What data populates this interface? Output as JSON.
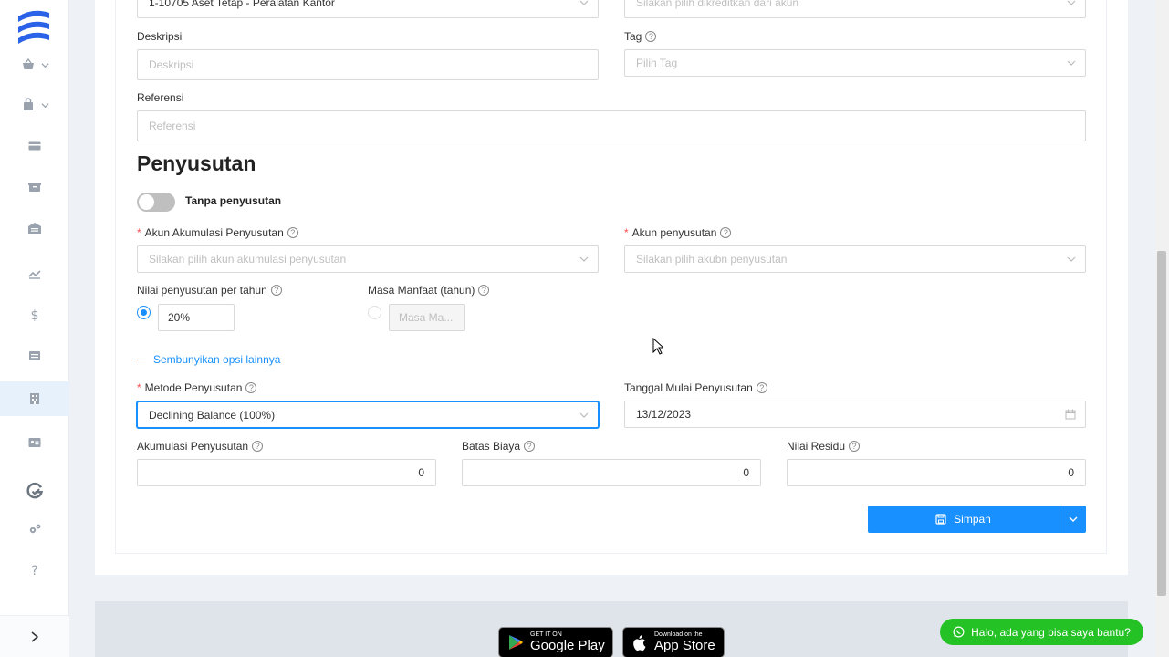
{
  "form": {
    "top_account_value": "1-10705 Aset Tetap - Peralatan Kantor",
    "top_credit_placeholder": "Silakan pilih dikreditkan dari akun",
    "description_label": "Deskripsi",
    "description_placeholder": "Deskripsi",
    "tag_label": "Tag",
    "tag_placeholder": "Pilih Tag",
    "reference_label": "Referensi",
    "reference_placeholder": "Referensi"
  },
  "depreciation": {
    "title": "Penyusutan",
    "toggle_label": "Tanpa penyusutan",
    "accum_account_label": "Akun Akumulasi Penyusutan",
    "accum_account_placeholder": "Silakan pilih akun akumulasi penyusutan",
    "dep_account_label": "Akun penyusutan",
    "dep_account_placeholder": "Silakan pilih akubn penyusutan",
    "yearly_value_label": "Nilai penyusutan per tahun",
    "yearly_value": "20%",
    "useful_life_label": "Masa Manfaat (tahun)",
    "useful_life_placeholder": "Masa Ma...",
    "hide_options_link": "Sembunyikan opsi lainnya",
    "method_label": "Metode Penyusutan",
    "method_value": "Declining Balance (100%)",
    "start_date_label": "Tanggal Mulai Penyusutan",
    "start_date_value": "13/12/2023",
    "accumulated_label": "Akumulasi Penyusutan",
    "accumulated_value": "0",
    "cost_limit_label": "Batas Biaya",
    "cost_limit_value": "0",
    "residual_label": "Nilai Residu",
    "residual_value": "0",
    "required_mark": "*",
    "help_mark": "?"
  },
  "actions": {
    "save_label": "Simpan"
  },
  "footer": {
    "google_small": "GET IT ON",
    "google_big": "Google Play",
    "apple_small": "Download on the",
    "apple_big": "App Store"
  },
  "chat": {
    "whatsapp_label": "Halo, ada yang bisa saya bantu?"
  },
  "sidebar": {
    "expand_glyph": ">",
    "help_glyph": "?",
    "dollar_glyph": "$"
  },
  "colors": {
    "accent": "#1890ff",
    "whatsapp": "#25c226",
    "required": "#ff4d4f"
  }
}
